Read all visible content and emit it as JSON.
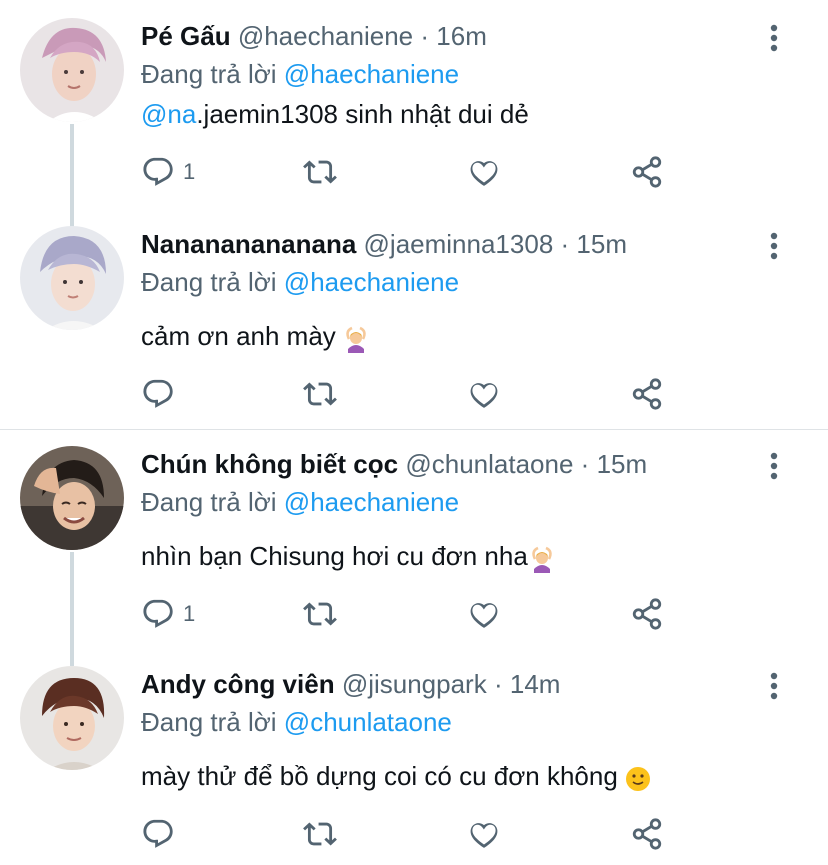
{
  "replying_label": "Đang trả lời",
  "tweets": [
    {
      "name": "Pé Gấu",
      "handle": "@haechaniene",
      "dot": "·",
      "time": "16m",
      "reply_to": "@haechaniene",
      "text_link": "@na",
      "text": ".jaemin1308 sinh nhật dui dẻ",
      "reply_count": "1"
    },
    {
      "name": "Nanananananana",
      "handle": "@jaeminna1308",
      "dot": "·",
      "time": "15m",
      "reply_to": "@haechaniene",
      "text": "cảm ơn anh mày",
      "text_emoji": "person-gesturing-ok-emoji",
      "reply_count": ""
    },
    {
      "name": "Chún không biết cọc",
      "handle": "@chunlataone",
      "dot": "·",
      "time": "15m",
      "reply_to": "@haechaniene",
      "text": "nhìn bạn Chisung hơi cu đơn nha",
      "text_emoji": "person-gesturing-ok-emoji",
      "reply_count": "1"
    },
    {
      "name": "Andy công viên",
      "handle": "@jisungpark",
      "dot": "·",
      "time": "14m",
      "reply_to": "@chunlataone",
      "text": "mày thử để bồ dựng coi có cu đơn không",
      "text_emoji": "slightly-smiling-face-emoji",
      "reply_count": ""
    }
  ],
  "colors": {
    "link": "#1d9bf0",
    "muted": "#536471",
    "text": "#0f1419",
    "thread_line": "#cfd9de"
  },
  "icons": [
    "reply-icon",
    "retweet-icon",
    "like-icon",
    "share-icon",
    "more-icon"
  ]
}
